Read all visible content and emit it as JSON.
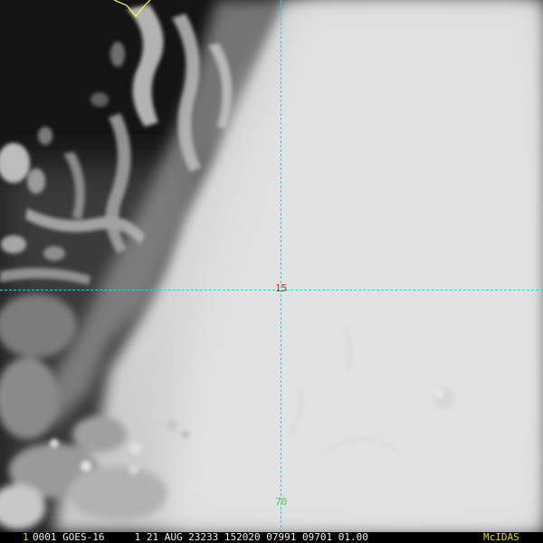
{
  "overlay": {
    "latitude_label": "15",
    "longitude_label": "70"
  },
  "status_bar": {
    "frame_number": "1",
    "text": "0001 GOES-16     1 21 AUG 23233 152020 07991 09701 01.00",
    "software": "McIDAS"
  },
  "colors": {
    "grid": "#2fd0d0",
    "latitude_label": "#e02020",
    "longitude_label": "#4cd04c",
    "frame_number": "#e8d800",
    "status_text": "#f0f0f0",
    "software": "#e8d800",
    "coastline": "#ffff40"
  }
}
